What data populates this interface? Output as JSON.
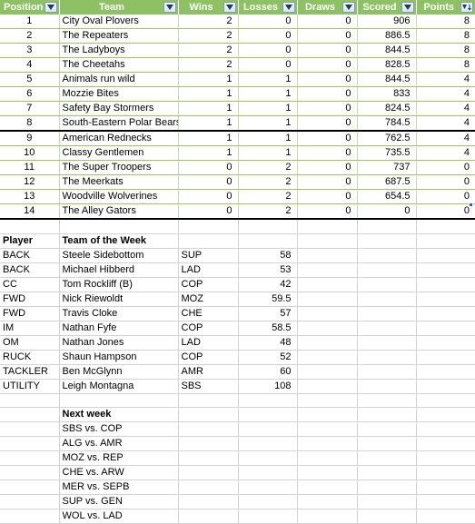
{
  "ladder": {
    "columns": [
      {
        "label": "Position",
        "filter": "filter-dropdown",
        "sorted": false
      },
      {
        "label": "Team",
        "filter": "filter-dropdown",
        "sorted": false
      },
      {
        "label": "Wins",
        "filter": "filter-dropdown",
        "sorted": false
      },
      {
        "label": "Losses",
        "filter": "filter-dropdown",
        "sorted": false
      },
      {
        "label": "Draws",
        "filter": "filter-dropdown",
        "sorted": false
      },
      {
        "label": "Scored",
        "filter": "filter-dropdown",
        "sorted": false
      },
      {
        "label": "Points",
        "filter": "filter-dropdown-sorted-descending",
        "sorted": true
      }
    ],
    "rows": [
      {
        "position": "1",
        "team": "City Oval Plovers",
        "wins": "2",
        "losses": "0",
        "draws": "0",
        "scored": "906",
        "points": "8"
      },
      {
        "position": "2",
        "team": "The Repeaters",
        "wins": "2",
        "losses": "0",
        "draws": "0",
        "scored": "886.5",
        "points": "8"
      },
      {
        "position": "3",
        "team": "The Ladyboys",
        "wins": "2",
        "losses": "0",
        "draws": "0",
        "scored": "844.5",
        "points": "8"
      },
      {
        "position": "4",
        "team": "The Cheetahs",
        "wins": "2",
        "losses": "0",
        "draws": "0",
        "scored": "828.5",
        "points": "8"
      },
      {
        "position": "5",
        "team": "Animals run wild",
        "wins": "1",
        "losses": "1",
        "draws": "0",
        "scored": "844.5",
        "points": "4"
      },
      {
        "position": "6",
        "team": "Mozzie Bites",
        "wins": "1",
        "losses": "1",
        "draws": "0",
        "scored": "833",
        "points": "4"
      },
      {
        "position": "7",
        "team": "Safety Bay Stormers",
        "wins": "1",
        "losses": "1",
        "draws": "0",
        "scored": "824.5",
        "points": "4"
      },
      {
        "position": "8",
        "team": "South-Eastern Polar Bears",
        "wins": "1",
        "losses": "1",
        "draws": "0",
        "scored": "784.5",
        "points": "4"
      },
      {
        "position": "9",
        "team": "American Rednecks",
        "wins": "1",
        "losses": "1",
        "draws": "0",
        "scored": "762.5",
        "points": "4"
      },
      {
        "position": "10",
        "team": "Classy Gentlemen",
        "wins": "1",
        "losses": "1",
        "draws": "0",
        "scored": "735.5",
        "points": "4"
      },
      {
        "position": "11",
        "team": "The Super Troopers",
        "wins": "0",
        "losses": "2",
        "draws": "0",
        "scored": "737",
        "points": "0"
      },
      {
        "position": "12",
        "team": "The Meerkats",
        "wins": "0",
        "losses": "2",
        "draws": "0",
        "scored": "687.5",
        "points": "0"
      },
      {
        "position": "13",
        "team": "Woodville Wolverines",
        "wins": "0",
        "losses": "2",
        "draws": "0",
        "scored": "654.5",
        "points": "0"
      },
      {
        "position": "14",
        "team": "The Alley Gators",
        "wins": "0",
        "losses": "2",
        "draws": "0",
        "scored": "0",
        "points": "0"
      }
    ],
    "finals_cut_after_row": 8,
    "accent_color": "#8DC163",
    "gridline_color": "#9DC45E"
  },
  "team_of_the_week": {
    "header": {
      "col0": "Player",
      "col1": "Team of the Week"
    },
    "rows": [
      {
        "position": "BACK",
        "player": "Steele Sidebottom",
        "team_abbr": "SUP",
        "score": "58"
      },
      {
        "position": "BACK",
        "player": "Michael Hibberd",
        "team_abbr": "LAD",
        "score": "53"
      },
      {
        "position": "CC",
        "player": "Tom Rockliff (B)",
        "team_abbr": "COP",
        "score": "42"
      },
      {
        "position": "FWD",
        "player": "Nick Riewoldt",
        "team_abbr": "MOZ",
        "score": "59.5"
      },
      {
        "position": "FWD",
        "player": "Travis Cloke",
        "team_abbr": "CHE",
        "score": "57"
      },
      {
        "position": "IM",
        "player": "Nathan Fyfe",
        "team_abbr": "COP",
        "score": "58.5"
      },
      {
        "position": "OM",
        "player": "Nathan Jones",
        "team_abbr": "LAD",
        "score": "48"
      },
      {
        "position": "RUCK",
        "player": "Shaun Hampson",
        "team_abbr": "COP",
        "score": "52"
      },
      {
        "position": "TACKLER",
        "player": "Ben McGlynn",
        "team_abbr": "AMR",
        "score": "60"
      },
      {
        "position": "UTILITY",
        "player": "Leigh Montagna",
        "team_abbr": "SBS",
        "score": "108"
      }
    ]
  },
  "next_week": {
    "header": "Next week",
    "fixtures": [
      "SBS vs. COP",
      "ALG vs. AMR",
      "MOZ vs. REP",
      "CHE vs. ARW",
      "MER vs. SEPB",
      "SUP vs. GEN",
      "WOL vs. LAD"
    ]
  }
}
